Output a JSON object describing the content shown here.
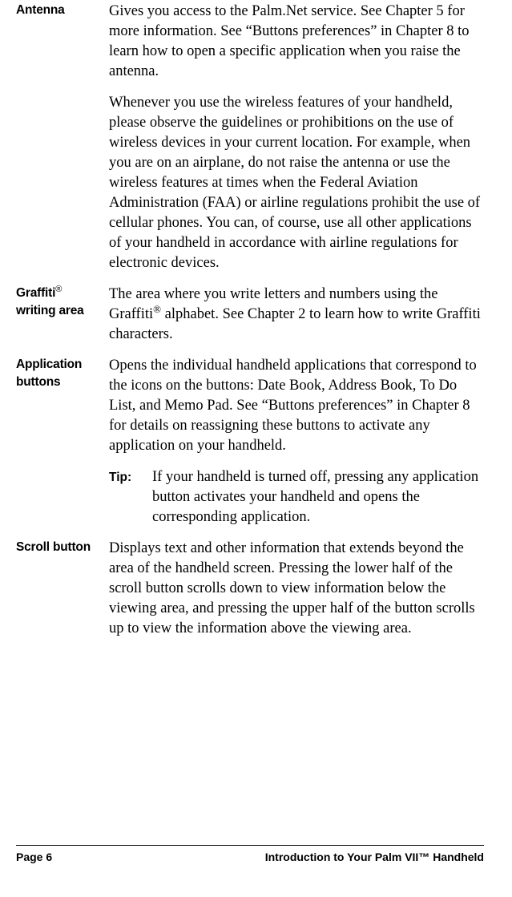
{
  "entries": [
    {
      "term_html": "Antenna",
      "paragraphs": [
        "Gives you access to the Palm.Net service. See Chapter 5 for more information. See “Buttons preferences” in Chapter 8 to learn how to open a specific application when you raise the antenna.",
        "Whenever you use the wireless features of your handheld, please observe the guidelines or prohibitions on the use of wireless devices in your current location. For example, when you are on an airplane, do not raise the antenna or use the wireless features at times when the Federal Aviation Administration (FAA) or airline regulations prohibit the use of cellular phones. You can, of course, use all other applications of your handheld in accordance with airline regulations for electronic devices."
      ]
    },
    {
      "term_html": "Graffiti<span class=\"reg\">®</span> writing area",
      "paragraphs": [
        "The area where you write letters and numbers using the Graffiti<span class=\"inline-reg\">®</span> alphabet. See Chapter 2 to learn how to write Graffiti characters."
      ]
    },
    {
      "term_html": "Application buttons",
      "paragraphs": [
        "Opens the individual handheld applications that correspond to the icons on the buttons: Date Book, Address Book, To Do List, and Memo Pad. See “Buttons preferences” in Chapter 8 for details on reassigning these buttons to activate any application on your handheld."
      ],
      "tip_label": "Tip:",
      "tip_text": "If your handheld is turned off, pressing any application button activates your handheld and opens the corresponding application."
    },
    {
      "term_html": "Scroll button",
      "paragraphs": [
        "Displays text and other information that extends beyond the area of the handheld screen. Pressing the lower half of the scroll button scrolls down to view information below the viewing area, and pressing the upper half of the button scrolls up to view the information above the viewing area."
      ]
    }
  ],
  "footer": {
    "left": "Page 6",
    "right": "Introduction to Your Palm VII™ Handheld"
  }
}
